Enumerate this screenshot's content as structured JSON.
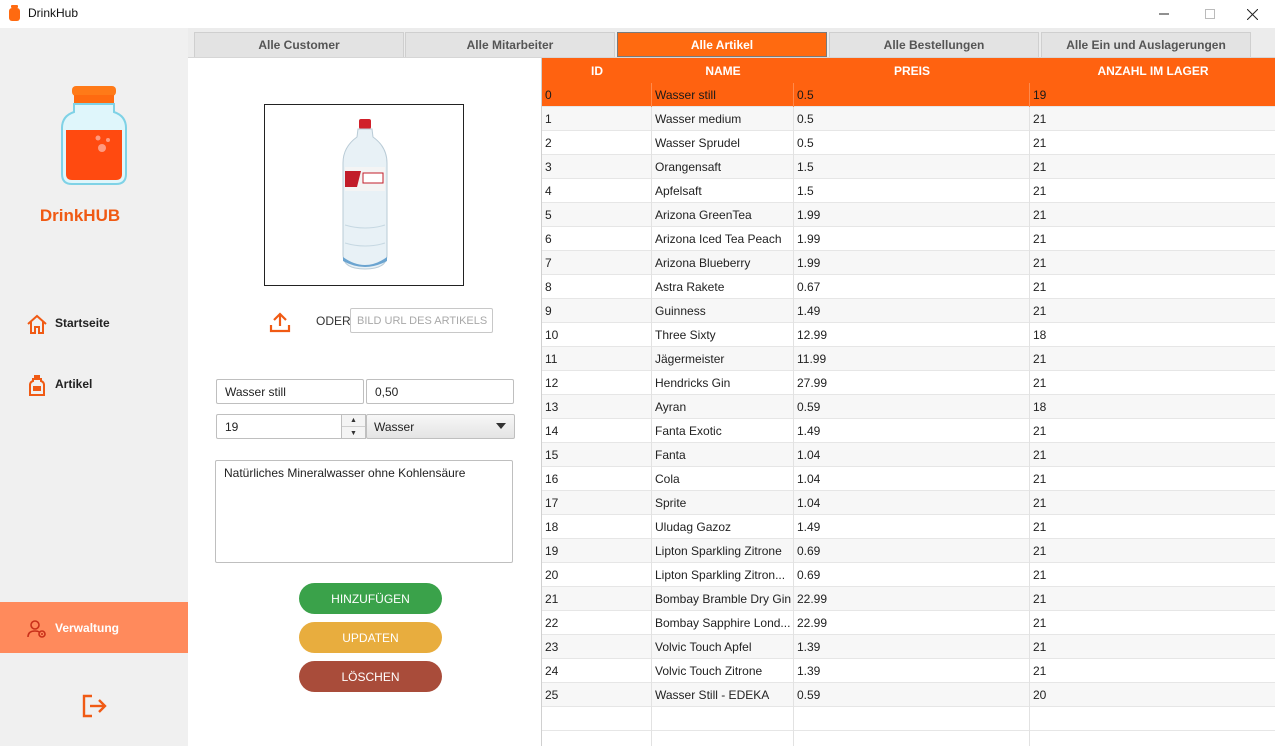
{
  "window": {
    "title": "DrinkHub",
    "controls": {
      "minimize": "—",
      "maximize": "☐",
      "close": "✕"
    }
  },
  "colors": {
    "accent": "#ff6210",
    "sidebar_active": "#ff8a5c",
    "add": "#3aa24a",
    "update": "#e8ad3e",
    "delete": "#a94c3a"
  },
  "sidebar": {
    "brand": "DrinkHUB",
    "items": [
      {
        "label": "Startseite",
        "icon": "home-icon"
      },
      {
        "label": "Artikel",
        "icon": "bottle-icon"
      },
      {
        "label": "Verwaltung",
        "icon": "admin-icon",
        "active": true
      }
    ],
    "logout_icon": "logout-icon"
  },
  "tabs": [
    {
      "label": "Alle Customer"
    },
    {
      "label": "Alle Mitarbeiter"
    },
    {
      "label": "Alle Artikel",
      "active": true
    },
    {
      "label": "Alle Bestellungen"
    },
    {
      "label": "Alle Ein und Auslagerungen"
    }
  ],
  "form": {
    "oder_label": "ODER",
    "url_placeholder": "BILD URL DES ARTIKELS",
    "name_value": "Wasser still",
    "price_value": "0,50",
    "quantity_value": "19",
    "category_value": "Wasser",
    "description_value": "Natürliches Mineralwasser ohne Kohlensäure",
    "buttons": {
      "add": "HINZUFÜGEN",
      "update": "UPDATEN",
      "delete": "LÖSCHEN"
    }
  },
  "table": {
    "columns": [
      "ID",
      "NAME",
      "PREIS",
      "ANZAHL IM LAGER"
    ],
    "selected_index": 0,
    "rows": [
      [
        "0",
        "Wasser still",
        "0.5",
        "19"
      ],
      [
        "1",
        "Wasser medium",
        "0.5",
        "21"
      ],
      [
        "2",
        "Wasser Sprudel",
        "0.5",
        "21"
      ],
      [
        "3",
        "Orangensaft",
        "1.5",
        "21"
      ],
      [
        "4",
        "Apfelsaft",
        "1.5",
        "21"
      ],
      [
        "5",
        "Arizona GreenTea",
        "1.99",
        "21"
      ],
      [
        "6",
        "Arizona Iced Tea Peach",
        "1.99",
        "21"
      ],
      [
        "7",
        "Arizona Blueberry",
        "1.99",
        "21"
      ],
      [
        "8",
        "Astra Rakete",
        "0.67",
        "21"
      ],
      [
        "9",
        "Guinness",
        "1.49",
        "21"
      ],
      [
        "10",
        "Three Sixty",
        "12.99",
        "18"
      ],
      [
        "11",
        "Jägermeister",
        "11.99",
        "21"
      ],
      [
        "12",
        "Hendricks Gin",
        "27.99",
        "21"
      ],
      [
        "13",
        "Ayran",
        "0.59",
        "18"
      ],
      [
        "14",
        "Fanta Exotic",
        "1.49",
        "21"
      ],
      [
        "15",
        "Fanta",
        "1.04",
        "21"
      ],
      [
        "16",
        "Cola",
        "1.04",
        "21"
      ],
      [
        "17",
        "Sprite",
        "1.04",
        "21"
      ],
      [
        "18",
        "Uludag Gazoz",
        "1.49",
        "21"
      ],
      [
        "19",
        "Lipton Sparkling Zitrone",
        "0.69",
        "21"
      ],
      [
        "20",
        "Lipton Sparkling Zitron...",
        "0.69",
        "21"
      ],
      [
        "21",
        "Bombay Bramble Dry Gin",
        "22.99",
        "21"
      ],
      [
        "22",
        "Bombay Sapphire Lond...",
        "22.99",
        "21"
      ],
      [
        "23",
        "Volvic Touch Apfel",
        "1.39",
        "21"
      ],
      [
        "24",
        "Volvic Touch Zitrone",
        "1.39",
        "21"
      ],
      [
        "25",
        "Wasser Still - EDEKA",
        "0.59",
        "20"
      ]
    ]
  }
}
